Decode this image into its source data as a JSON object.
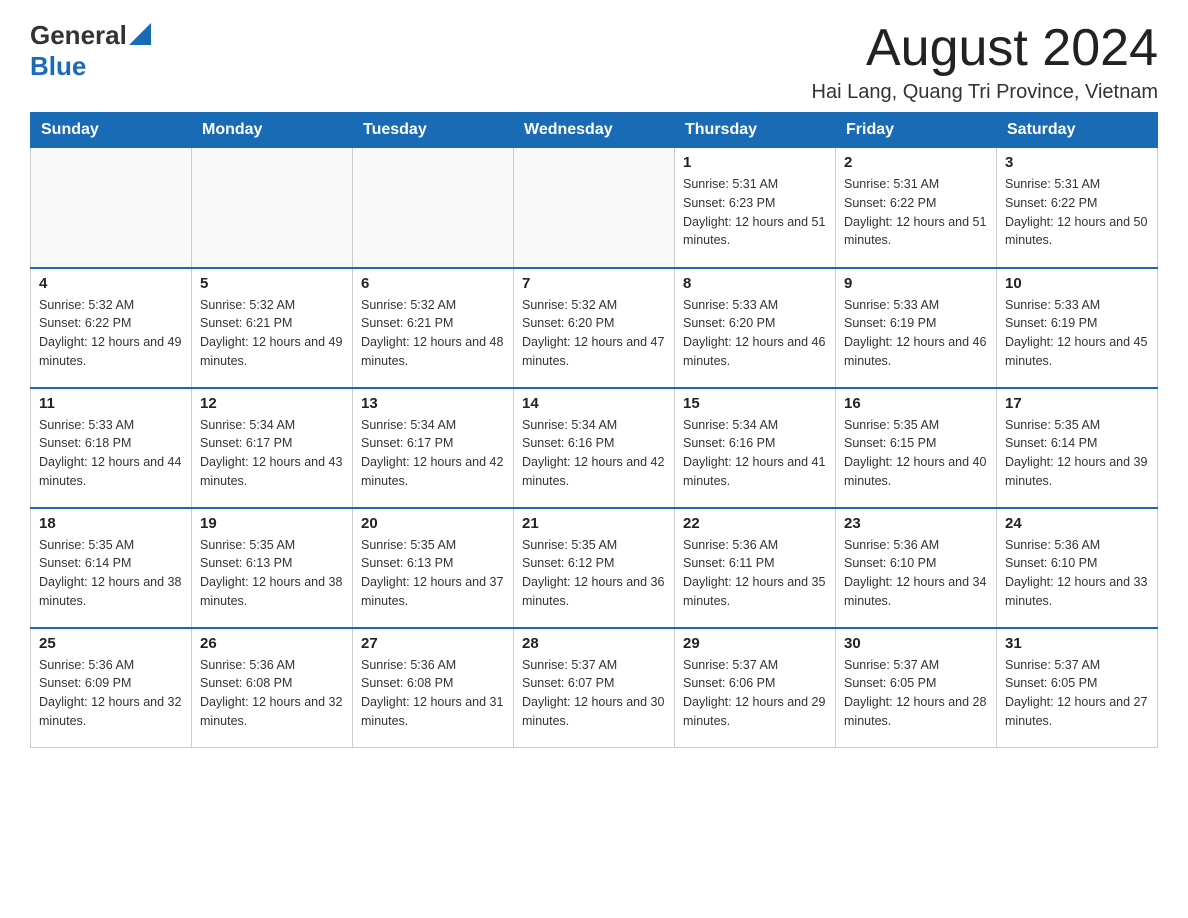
{
  "header": {
    "logo_general": "General",
    "logo_blue": "Blue",
    "month_title": "August 2024",
    "location": "Hai Lang, Quang Tri Province, Vietnam"
  },
  "weekdays": [
    "Sunday",
    "Monday",
    "Tuesday",
    "Wednesday",
    "Thursday",
    "Friday",
    "Saturday"
  ],
  "weeks": [
    [
      {
        "day": "",
        "sunrise": "",
        "sunset": "",
        "daylight": ""
      },
      {
        "day": "",
        "sunrise": "",
        "sunset": "",
        "daylight": ""
      },
      {
        "day": "",
        "sunrise": "",
        "sunset": "",
        "daylight": ""
      },
      {
        "day": "",
        "sunrise": "",
        "sunset": "",
        "daylight": ""
      },
      {
        "day": "1",
        "sunrise": "Sunrise: 5:31 AM",
        "sunset": "Sunset: 6:23 PM",
        "daylight": "Daylight: 12 hours and 51 minutes."
      },
      {
        "day": "2",
        "sunrise": "Sunrise: 5:31 AM",
        "sunset": "Sunset: 6:22 PM",
        "daylight": "Daylight: 12 hours and 51 minutes."
      },
      {
        "day": "3",
        "sunrise": "Sunrise: 5:31 AM",
        "sunset": "Sunset: 6:22 PM",
        "daylight": "Daylight: 12 hours and 50 minutes."
      }
    ],
    [
      {
        "day": "4",
        "sunrise": "Sunrise: 5:32 AM",
        "sunset": "Sunset: 6:22 PM",
        "daylight": "Daylight: 12 hours and 49 minutes."
      },
      {
        "day": "5",
        "sunrise": "Sunrise: 5:32 AM",
        "sunset": "Sunset: 6:21 PM",
        "daylight": "Daylight: 12 hours and 49 minutes."
      },
      {
        "day": "6",
        "sunrise": "Sunrise: 5:32 AM",
        "sunset": "Sunset: 6:21 PM",
        "daylight": "Daylight: 12 hours and 48 minutes."
      },
      {
        "day": "7",
        "sunrise": "Sunrise: 5:32 AM",
        "sunset": "Sunset: 6:20 PM",
        "daylight": "Daylight: 12 hours and 47 minutes."
      },
      {
        "day": "8",
        "sunrise": "Sunrise: 5:33 AM",
        "sunset": "Sunset: 6:20 PM",
        "daylight": "Daylight: 12 hours and 46 minutes."
      },
      {
        "day": "9",
        "sunrise": "Sunrise: 5:33 AM",
        "sunset": "Sunset: 6:19 PM",
        "daylight": "Daylight: 12 hours and 46 minutes."
      },
      {
        "day": "10",
        "sunrise": "Sunrise: 5:33 AM",
        "sunset": "Sunset: 6:19 PM",
        "daylight": "Daylight: 12 hours and 45 minutes."
      }
    ],
    [
      {
        "day": "11",
        "sunrise": "Sunrise: 5:33 AM",
        "sunset": "Sunset: 6:18 PM",
        "daylight": "Daylight: 12 hours and 44 minutes."
      },
      {
        "day": "12",
        "sunrise": "Sunrise: 5:34 AM",
        "sunset": "Sunset: 6:17 PM",
        "daylight": "Daylight: 12 hours and 43 minutes."
      },
      {
        "day": "13",
        "sunrise": "Sunrise: 5:34 AM",
        "sunset": "Sunset: 6:17 PM",
        "daylight": "Daylight: 12 hours and 42 minutes."
      },
      {
        "day": "14",
        "sunrise": "Sunrise: 5:34 AM",
        "sunset": "Sunset: 6:16 PM",
        "daylight": "Daylight: 12 hours and 42 minutes."
      },
      {
        "day": "15",
        "sunrise": "Sunrise: 5:34 AM",
        "sunset": "Sunset: 6:16 PM",
        "daylight": "Daylight: 12 hours and 41 minutes."
      },
      {
        "day": "16",
        "sunrise": "Sunrise: 5:35 AM",
        "sunset": "Sunset: 6:15 PM",
        "daylight": "Daylight: 12 hours and 40 minutes."
      },
      {
        "day": "17",
        "sunrise": "Sunrise: 5:35 AM",
        "sunset": "Sunset: 6:14 PM",
        "daylight": "Daylight: 12 hours and 39 minutes."
      }
    ],
    [
      {
        "day": "18",
        "sunrise": "Sunrise: 5:35 AM",
        "sunset": "Sunset: 6:14 PM",
        "daylight": "Daylight: 12 hours and 38 minutes."
      },
      {
        "day": "19",
        "sunrise": "Sunrise: 5:35 AM",
        "sunset": "Sunset: 6:13 PM",
        "daylight": "Daylight: 12 hours and 38 minutes."
      },
      {
        "day": "20",
        "sunrise": "Sunrise: 5:35 AM",
        "sunset": "Sunset: 6:13 PM",
        "daylight": "Daylight: 12 hours and 37 minutes."
      },
      {
        "day": "21",
        "sunrise": "Sunrise: 5:35 AM",
        "sunset": "Sunset: 6:12 PM",
        "daylight": "Daylight: 12 hours and 36 minutes."
      },
      {
        "day": "22",
        "sunrise": "Sunrise: 5:36 AM",
        "sunset": "Sunset: 6:11 PM",
        "daylight": "Daylight: 12 hours and 35 minutes."
      },
      {
        "day": "23",
        "sunrise": "Sunrise: 5:36 AM",
        "sunset": "Sunset: 6:10 PM",
        "daylight": "Daylight: 12 hours and 34 minutes."
      },
      {
        "day": "24",
        "sunrise": "Sunrise: 5:36 AM",
        "sunset": "Sunset: 6:10 PM",
        "daylight": "Daylight: 12 hours and 33 minutes."
      }
    ],
    [
      {
        "day": "25",
        "sunrise": "Sunrise: 5:36 AM",
        "sunset": "Sunset: 6:09 PM",
        "daylight": "Daylight: 12 hours and 32 minutes."
      },
      {
        "day": "26",
        "sunrise": "Sunrise: 5:36 AM",
        "sunset": "Sunset: 6:08 PM",
        "daylight": "Daylight: 12 hours and 32 minutes."
      },
      {
        "day": "27",
        "sunrise": "Sunrise: 5:36 AM",
        "sunset": "Sunset: 6:08 PM",
        "daylight": "Daylight: 12 hours and 31 minutes."
      },
      {
        "day": "28",
        "sunrise": "Sunrise: 5:37 AM",
        "sunset": "Sunset: 6:07 PM",
        "daylight": "Daylight: 12 hours and 30 minutes."
      },
      {
        "day": "29",
        "sunrise": "Sunrise: 5:37 AM",
        "sunset": "Sunset: 6:06 PM",
        "daylight": "Daylight: 12 hours and 29 minutes."
      },
      {
        "day": "30",
        "sunrise": "Sunrise: 5:37 AM",
        "sunset": "Sunset: 6:05 PM",
        "daylight": "Daylight: 12 hours and 28 minutes."
      },
      {
        "day": "31",
        "sunrise": "Sunrise: 5:37 AM",
        "sunset": "Sunset: 6:05 PM",
        "daylight": "Daylight: 12 hours and 27 minutes."
      }
    ]
  ]
}
